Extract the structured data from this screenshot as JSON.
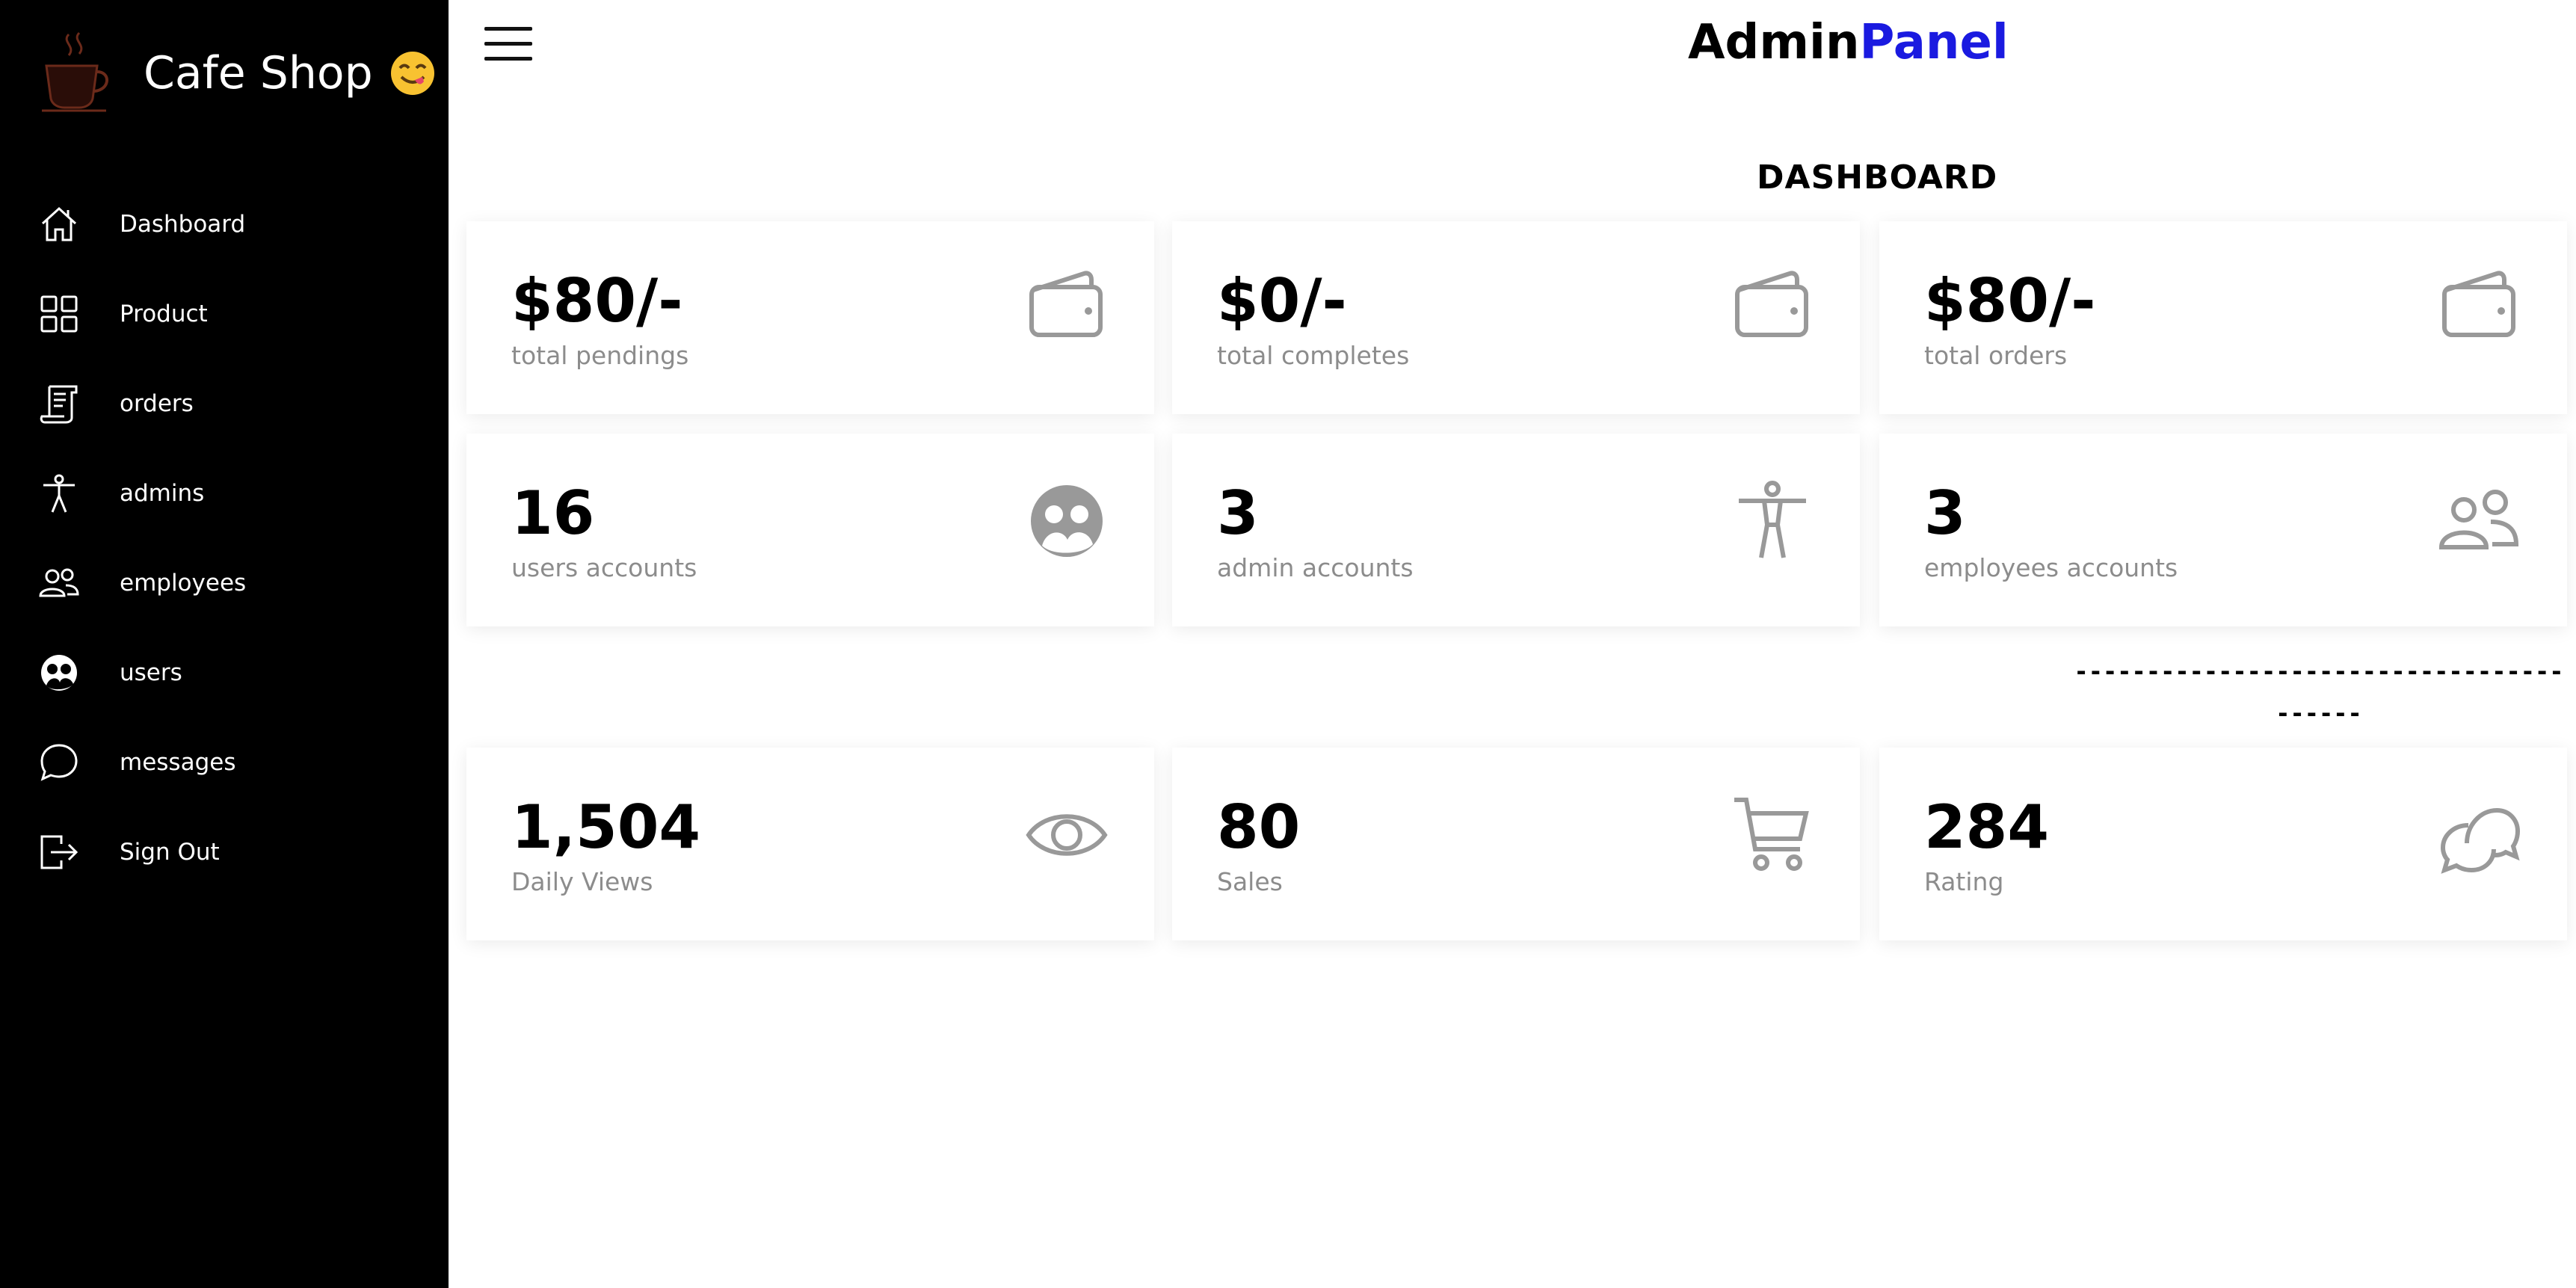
{
  "brand": {
    "name": "Cafe Shop",
    "emoji": "😋",
    "logo_icon": "coffee-cup-icon"
  },
  "nav": [
    {
      "label": "Dashboard",
      "icon": "home-icon"
    },
    {
      "label": "Product",
      "icon": "grid-icon"
    },
    {
      "label": "orders",
      "icon": "receipt-icon"
    },
    {
      "label": "admins",
      "icon": "accessibility-icon"
    },
    {
      "label": "employees",
      "icon": "people-icon"
    },
    {
      "label": "users",
      "icon": "user-face-icon"
    },
    {
      "label": "messages",
      "icon": "chat-bubble-icon"
    },
    {
      "label": "Sign Out",
      "icon": "sign-out-icon"
    }
  ],
  "header": {
    "title_part1": "Admin",
    "title_part2": "Panel",
    "accent_color": "#1a1ae0"
  },
  "page": {
    "title": "DASHBOARD"
  },
  "stats_row1": [
    {
      "value": "$80/-",
      "label": "total pendings",
      "icon": "wallet-icon"
    },
    {
      "value": "$0/-",
      "label": "total completes",
      "icon": "wallet-icon"
    },
    {
      "value": "$80/-",
      "label": "total orders",
      "icon": "wallet-icon"
    }
  ],
  "stats_row2": [
    {
      "value": "16",
      "label": "users accounts",
      "icon": "user-face-icon"
    },
    {
      "value": "3",
      "label": "admin accounts",
      "icon": "accessibility-icon"
    },
    {
      "value": "3",
      "label": "employees accounts",
      "icon": "people-icon"
    }
  ],
  "divider": {
    "line1": "----------------------------------------",
    "line2": "-----------"
  },
  "stats_row3": [
    {
      "value": "1,504",
      "label": "Daily Views",
      "icon": "eye-icon"
    },
    {
      "value": "80",
      "label": "Sales",
      "icon": "cart-icon"
    },
    {
      "value": "284",
      "label": "Rating",
      "icon": "chat-bubbles-icon"
    }
  ]
}
